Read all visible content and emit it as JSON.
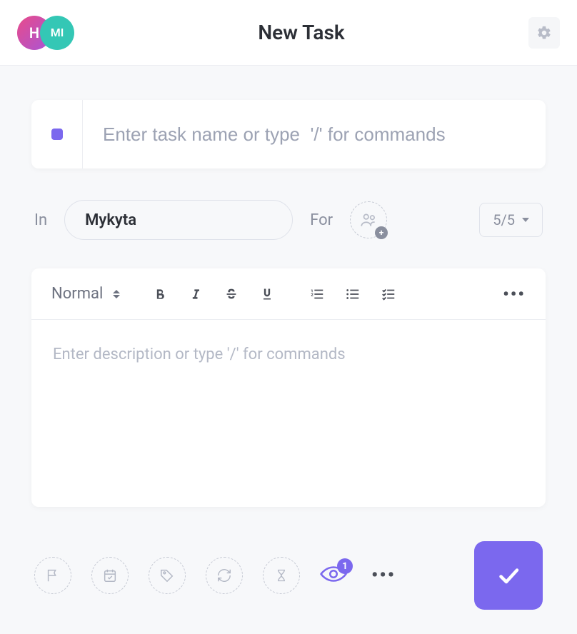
{
  "header": {
    "title": "New Task",
    "avatars": [
      {
        "label": "H"
      },
      {
        "label": "MI"
      }
    ]
  },
  "taskName": {
    "placeholder": "Enter task name or type  '/' for commands",
    "value": ""
  },
  "meta": {
    "inLabel": "In",
    "listName": "Mykyta",
    "forLabel": "For",
    "priority": "5/5"
  },
  "editor": {
    "formatLabel": "Normal",
    "descriptionPlaceholder": "Enter description or type '/' for commands"
  },
  "footer": {
    "watchersCount": "1"
  }
}
